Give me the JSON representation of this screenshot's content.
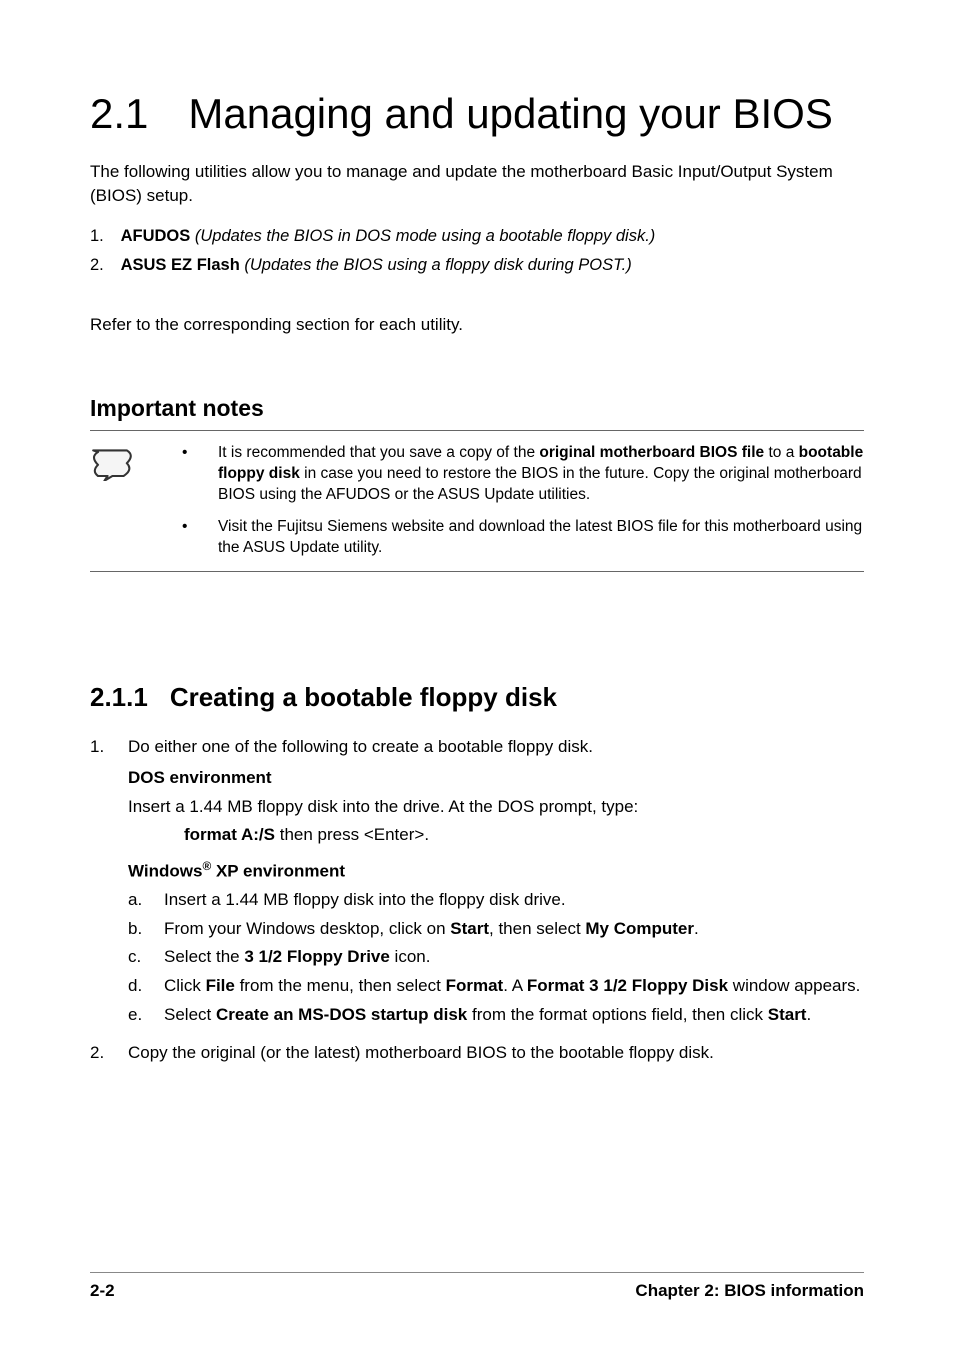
{
  "title": {
    "num": "2.1",
    "text": "Managing and updating your BIOS"
  },
  "intro": "The following utilities allow you to manage and update the motherboard Basic Input/Output System (BIOS) setup.",
  "utils": [
    {
      "num": "1.",
      "name": "AFUDOS",
      "desc": "(Updates the BIOS in DOS mode using a bootable floppy disk.)"
    },
    {
      "num": "2.",
      "name": "ASUS EZ Flash",
      "desc": "(Updates the BIOS using a floppy disk during POST.)"
    }
  ],
  "refer": "Refer to the corresponding section for each utility.",
  "notes_heading": "Important notes",
  "notes": [
    {
      "pre": "It is recommended that you save a copy of the ",
      "b1": "original motherboard BIOS file",
      "mid": " to a ",
      "b2": "bootable floppy disk",
      "post": " in case you need to restore the BIOS in the future. Copy the original motherboard BIOS using the AFUDOS or the ASUS Update utilities."
    },
    {
      "text": "Visit the Fujitsu Siemens website and download the latest BIOS file for this motherboard using the ASUS Update utility."
    }
  ],
  "section": {
    "num": "2.1.1",
    "text": "Creating a bootable floppy disk"
  },
  "steps": {
    "step1": {
      "num": "1.",
      "text": "Do either one of the following to create a bootable floppy disk.",
      "dos_heading": "DOS environment",
      "dos_text": "Insert a 1.44 MB floppy disk into the drive. At the DOS prompt, type:",
      "cmd": "format A:/S",
      "cmd_after": "   then press <Enter>.",
      "win_heading_pre": "Windows",
      "win_heading_sup": "®",
      "win_heading_post": " XP environment",
      "sub": [
        {
          "l": "a.",
          "t": "Insert a 1.44 MB floppy disk into the floppy disk drive."
        },
        {
          "l": "b.",
          "pre": "From your Windows desktop, click on ",
          "b1": "Start",
          "mid": ", then select ",
          "b2": "My Computer",
          "post": "."
        },
        {
          "l": "c.",
          "pre": "Select the ",
          "b1": "3 1/2 Floppy Drive",
          "post": " icon."
        },
        {
          "l": "d.",
          "pre": "Click ",
          "b1": "File",
          "m1": " from the menu, then select ",
          "b2": "Format",
          "m2": ". A ",
          "b3": "Format 3 1/2 Floppy Disk",
          "post": " window appears."
        },
        {
          "l": "e.",
          "pre": "Select ",
          "b1": "Create an MS-DOS startup disk",
          "mid": " from the format options field, then click ",
          "b2": "Start",
          "post": "."
        }
      ]
    },
    "step2": {
      "num": "2.",
      "text": "Copy the original (or the latest) motherboard BIOS to the bootable floppy disk."
    }
  },
  "footer": {
    "page": "2-2",
    "chapter": "Chapter 2: BIOS information"
  }
}
